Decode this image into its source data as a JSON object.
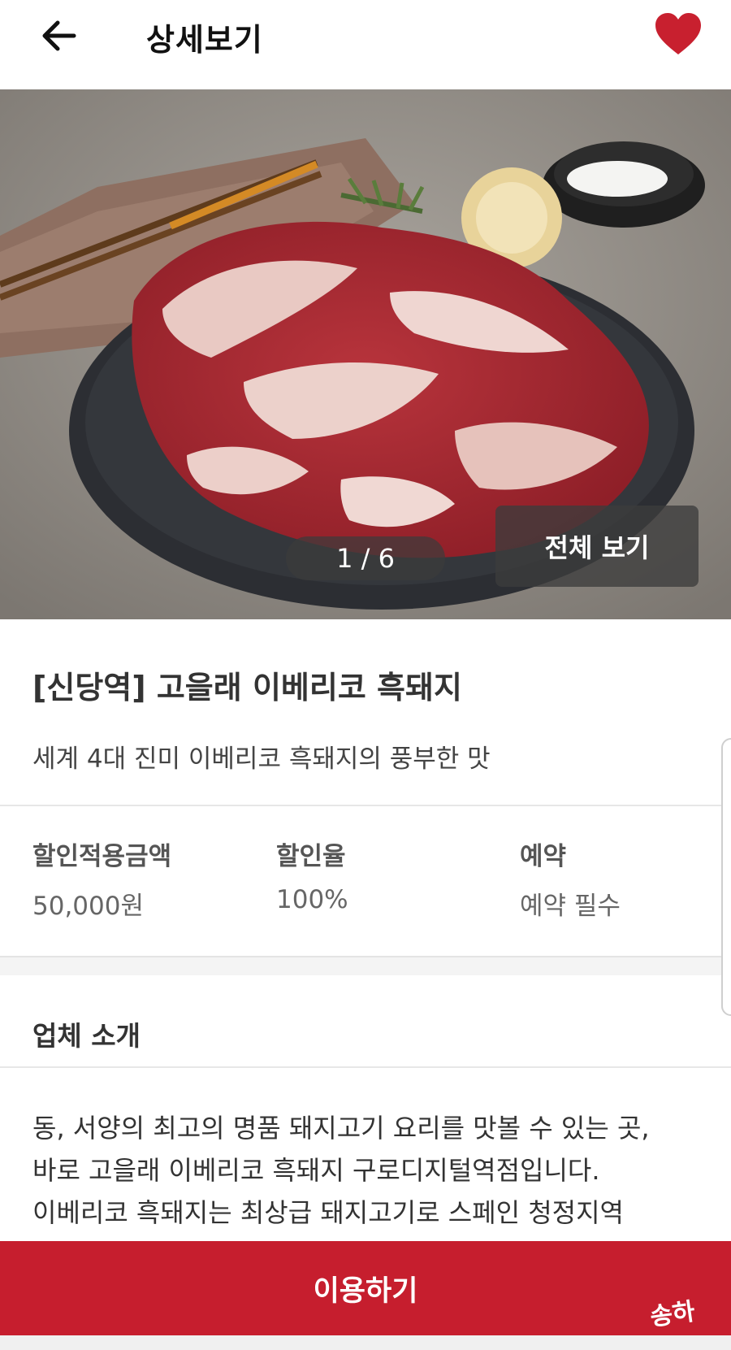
{
  "header": {
    "title": "상세보기",
    "back_icon": "arrow-left-icon",
    "favorite_icon": "heart-icon",
    "favorite_color": "#c8202f"
  },
  "gallery": {
    "page_indicator": "1 / 6",
    "view_all_label": "전체 보기"
  },
  "product": {
    "title": "[신당역] 고을래 이베리코 흑돼지",
    "subtitle": "세계 4대 진미 이베리코 흑돼지의 풍부한 맛"
  },
  "info": [
    {
      "label": "할인적용금액",
      "value": "50,000원"
    },
    {
      "label": "할인율",
      "value": "100%"
    },
    {
      "label": "예약",
      "value": "예약 필수"
    }
  ],
  "company": {
    "section_title": "업체 소개",
    "lines": [
      "동, 서양의 최고의 명품 돼지고기 요리를 맛볼 수 있는 곳,",
      "바로 고을래 이베리코 흑돼지 구로디지털역점입니다.",
      "이베리코 흑돼지는 최상급 돼지고기로 스페인 청정지역"
    ]
  },
  "cta": {
    "label": "이용하기",
    "color": "#c61e2e"
  },
  "watermark": "송하"
}
